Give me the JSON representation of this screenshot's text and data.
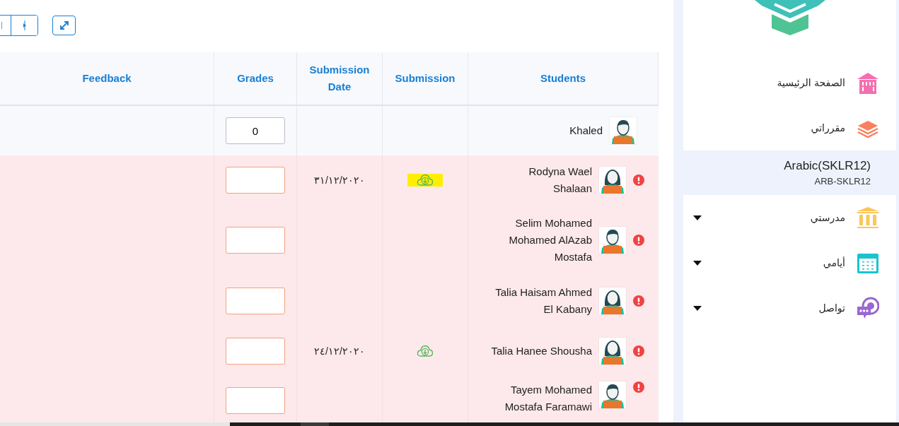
{
  "table": {
    "columns": [
      "Feedback",
      "Grades",
      "Submission Date",
      "Submission",
      "Students"
    ],
    "rows": [
      {
        "student": "Khaled",
        "avatar": {
          "kind": "male"
        },
        "warning": false,
        "grade": "0"
      },
      {
        "student": "Rodyna Wael Shalaan",
        "avatar": {
          "kind": "female"
        },
        "warning": true,
        "submission_date": "٣١/١٢/٢٠٢٠",
        "submission": {
          "highlighted": true
        }
      },
      {
        "student": "Selim Mohamed Mohamed AlAzab Mostafa",
        "avatar": {
          "kind": "male"
        },
        "warning": true
      },
      {
        "student": "Talia Haisam Ahmed El Kabany",
        "avatar": {
          "kind": "female"
        },
        "warning": true
      },
      {
        "student": "Talia Hanee Shousha",
        "avatar": {
          "kind": "female"
        },
        "warning": true,
        "submission_date": "٢٤/١٢/٢٠٢٠",
        "submission": {
          "highlighted": false
        }
      },
      {
        "student": "Tayem Mohamed Mostafa Faramawi",
        "avatar": {
          "kind": "male"
        },
        "warning": true
      }
    ]
  },
  "sidebar": {
    "items": [
      {
        "label": "الصفحة الرئيسية",
        "kind": "home",
        "expandable": false
      },
      {
        "label": "مقرراتي",
        "kind": "courses",
        "expandable": false,
        "children": [
          {
            "title": "Arabic(SKLR12)",
            "code": "ARB-SKLR12",
            "selected": true
          }
        ]
      },
      {
        "label": "مدرستي",
        "kind": "school",
        "expandable": true
      },
      {
        "label": "أيامي",
        "kind": "calendar",
        "expandable": true
      },
      {
        "label": "تواصل",
        "kind": "chat",
        "expandable": true
      }
    ]
  }
}
